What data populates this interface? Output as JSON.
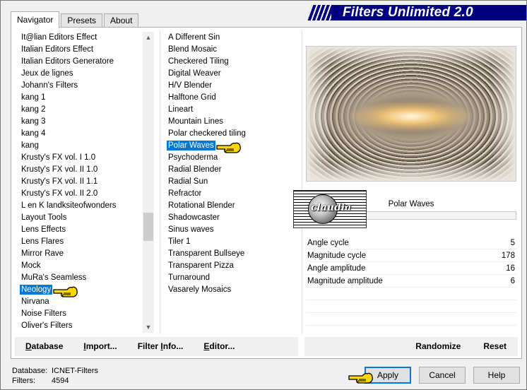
{
  "window": {
    "title": "Filters Unlimited 2.0"
  },
  "tabs": [
    {
      "label": "Navigator",
      "active": true
    },
    {
      "label": "Presets",
      "active": false
    },
    {
      "label": "About",
      "active": false
    }
  ],
  "categories": [
    "It@lian Editors Effect",
    "Italian Editors Effect",
    "Italian Editors Generatore",
    "Jeux de lignes",
    "Johann's Filters",
    "kang 1",
    "kang 2",
    "kang 3",
    "kang 4",
    "kang",
    "Krusty's FX vol. I 1.0",
    "Krusty's FX vol. II 1.0",
    "Krusty's FX vol. II 1.1",
    "Krusty's FX vol. II 2.0",
    "L en K landksiteofwonders",
    "Layout Tools",
    "Lens Effects",
    "Lens Flares",
    "Mirror Rave",
    "Mock",
    "MuRa's Seamless",
    "Neology",
    "Nirvana",
    "Noise Filters",
    "Oliver's Filters"
  ],
  "selected_category": "Neology",
  "filters": [
    "A Different Sin",
    "Blend Mosaic",
    "Checkered Tiling",
    "Digital Weaver",
    "H/V Blender",
    "Halftone Grid",
    "Lineart",
    "Mountain Lines",
    "Polar checkered tiling",
    "Polar Waves",
    "Psychoderma",
    "Radial Blender",
    "Radial Sun",
    "Refractor",
    "Rotational Blender",
    "Shadowcaster",
    "Sinus waves",
    "Tiler 1",
    "Transparent Bullseye",
    "Transparent Pizza",
    "Turnaround",
    "Vasarely Mosaics"
  ],
  "selected_filter": "Polar Waves",
  "preview": {
    "filter_name": "Polar Waves",
    "watermark": "claudia"
  },
  "params": [
    {
      "label": "Angle cycle",
      "value": "5"
    },
    {
      "label": "Magnitude cycle",
      "value": "178"
    },
    {
      "label": "Angle amplitude",
      "value": "16"
    },
    {
      "label": "Magnitude amplitude",
      "value": "6"
    }
  ],
  "left_buttons": {
    "database": {
      "pre": "",
      "u": "D",
      "post": "atabase"
    },
    "import": {
      "pre": "",
      "u": "I",
      "post": "mport..."
    },
    "filter_info": {
      "pre": "Filter ",
      "u": "I",
      "post": "nfo..."
    },
    "editor": {
      "pre": "",
      "u": "E",
      "post": "ditor..."
    }
  },
  "right_buttons": {
    "randomize": "Randomize",
    "reset": "Reset"
  },
  "footer": {
    "database_label": "Database:",
    "database_value": "ICNET-Filters",
    "filters_label": "Filters:",
    "filters_value": "4594"
  },
  "dialog_buttons": {
    "apply": "Apply",
    "cancel": "Cancel",
    "help": "Help"
  },
  "colors": {
    "title_bg": "#000080",
    "selection": "#0078d7",
    "hand": "#ffd700"
  }
}
